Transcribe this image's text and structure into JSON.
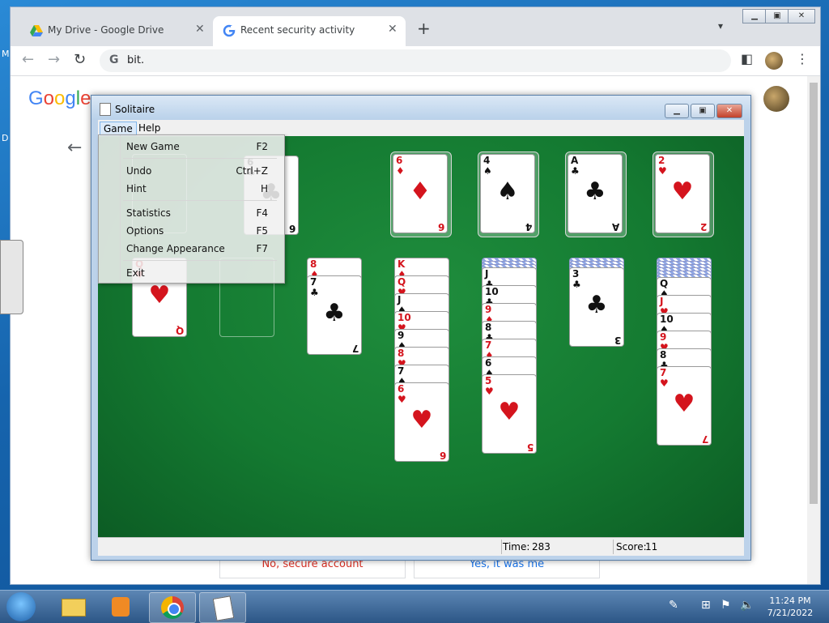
{
  "desktop": {
    "left_letters": [
      "M",
      "D"
    ]
  },
  "chrome": {
    "tabs": [
      {
        "title": "My Drive - Google Drive",
        "icon": "google-drive-icon"
      },
      {
        "title": "Recent security activity",
        "icon": "google-g-icon"
      }
    ],
    "new_tab": "+",
    "url": "bit.",
    "url_icon": "G",
    "page": {
      "logo": "Google",
      "buttons": [
        "No, secure account",
        "Yes, it was me"
      ]
    }
  },
  "solitaire": {
    "title": "Solitaire",
    "menu": [
      "Game",
      "Help"
    ],
    "dropdown": [
      {
        "label": "New Game",
        "key": "F2"
      },
      {
        "label": "Undo",
        "key": "Ctrl+Z"
      },
      {
        "label": "Hint",
        "key": "H"
      },
      {
        "label": "Statistics",
        "key": "F4"
      },
      {
        "label": "Options",
        "key": "F5"
      },
      {
        "label": "Change Appearance",
        "key": "F7"
      },
      {
        "label": "Exit",
        "key": ""
      }
    ],
    "status": {
      "time_label": "Time:",
      "time": "283",
      "score_label": "Score:",
      "score": "11"
    },
    "foundations": [
      {
        "rank": "6",
        "suit": "♦",
        "color": "red"
      },
      {
        "rank": "4",
        "suit": "♠",
        "color": "black"
      },
      {
        "rank": "A",
        "suit": "♣",
        "color": "black"
      },
      {
        "rank": "2",
        "suit": "♥",
        "color": "red"
      }
    ],
    "waste": {
      "rank": "6",
      "suit": "♣"
    },
    "columns": [
      {
        "hidden": 0,
        "cards": [
          {
            "rank": "Q",
            "suit": "♥",
            "color": "red"
          }
        ]
      },
      {
        "hidden": 0,
        "cards": []
      },
      {
        "hidden": 0,
        "cards": [
          {
            "rank": "8",
            "suit": "♦",
            "color": "red"
          },
          {
            "rank": "7",
            "suit": "♣",
            "color": "black"
          }
        ]
      },
      {
        "hidden": 0,
        "cards": [
          {
            "rank": "K",
            "suit": "♦",
            "color": "red"
          },
          {
            "rank": "Q",
            "suit": "♥",
            "color": "red"
          },
          {
            "rank": "J",
            "suit": "♠",
            "color": "black"
          },
          {
            "rank": "10",
            "suit": "♥",
            "color": "red"
          },
          {
            "rank": "9",
            "suit": "♠",
            "color": "black"
          },
          {
            "rank": "8",
            "suit": "♥",
            "color": "red"
          },
          {
            "rank": "7",
            "suit": "♠",
            "color": "black"
          },
          {
            "rank": "6",
            "suit": "♥",
            "color": "red"
          }
        ]
      },
      {
        "hidden": 3,
        "cards": [
          {
            "rank": "J",
            "suit": "♣",
            "color": "black"
          },
          {
            "rank": "10",
            "suit": "♣",
            "color": "black"
          },
          {
            "rank": "9",
            "suit": "♦",
            "color": "red"
          },
          {
            "rank": "8",
            "suit": "♣",
            "color": "black"
          },
          {
            "rank": "7",
            "suit": "♦",
            "color": "red"
          },
          {
            "rank": "6",
            "suit": "♠",
            "color": "black"
          },
          {
            "rank": "5",
            "suit": "♥",
            "color": "red"
          }
        ]
      },
      {
        "hidden": 3,
        "cards": [
          {
            "rank": "3",
            "suit": "♣",
            "color": "black"
          }
        ]
      },
      {
        "hidden": 6,
        "cards": [
          {
            "rank": "Q",
            "suit": "♠",
            "color": "black"
          },
          {
            "rank": "J",
            "suit": "♥",
            "color": "red"
          },
          {
            "rank": "10",
            "suit": "♠",
            "color": "black"
          },
          {
            "rank": "9",
            "suit": "♥",
            "color": "red"
          },
          {
            "rank": "8",
            "suit": "♣",
            "color": "black"
          },
          {
            "rank": "7",
            "suit": "♥",
            "color": "red"
          }
        ]
      }
    ]
  },
  "taskbar": {
    "time": "11:24 PM",
    "date": "7/21/2022",
    "items": [
      "file-explorer-icon",
      "media-player-icon",
      "chrome-icon",
      "solitaire-icon"
    ]
  }
}
